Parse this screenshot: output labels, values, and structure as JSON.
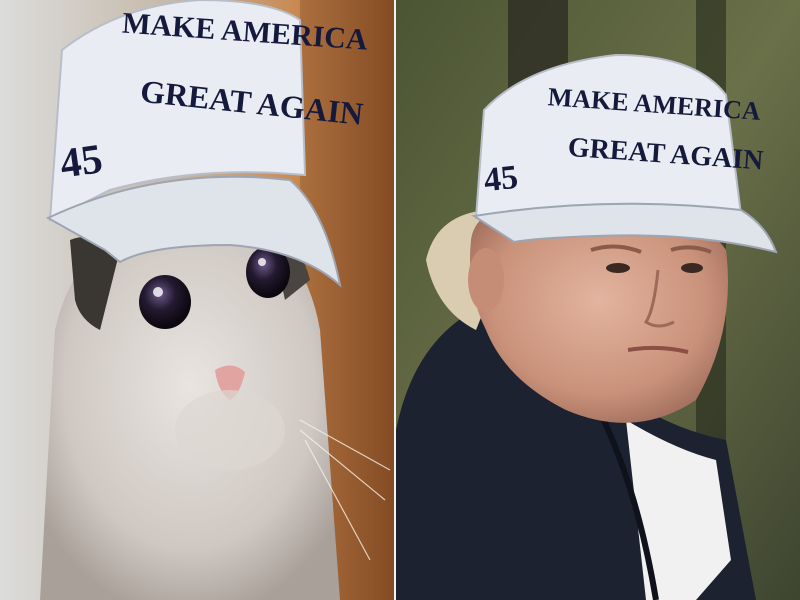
{
  "left_panel": {
    "cap_line1": "MAKE AMERICA",
    "cap_line2": "GREAT AGAIN",
    "cap_number": "45"
  },
  "right_panel": {
    "cap_line1": "MAKE AMERICA",
    "cap_line2": "GREAT AGAIN",
    "cap_number": "45"
  },
  "colors": {
    "cap_white": "#e9ecf2",
    "cap_text": "#151a3c",
    "left_bg": "#c98a52",
    "right_bg": "#5d6640",
    "jacket": "#1d2230"
  }
}
